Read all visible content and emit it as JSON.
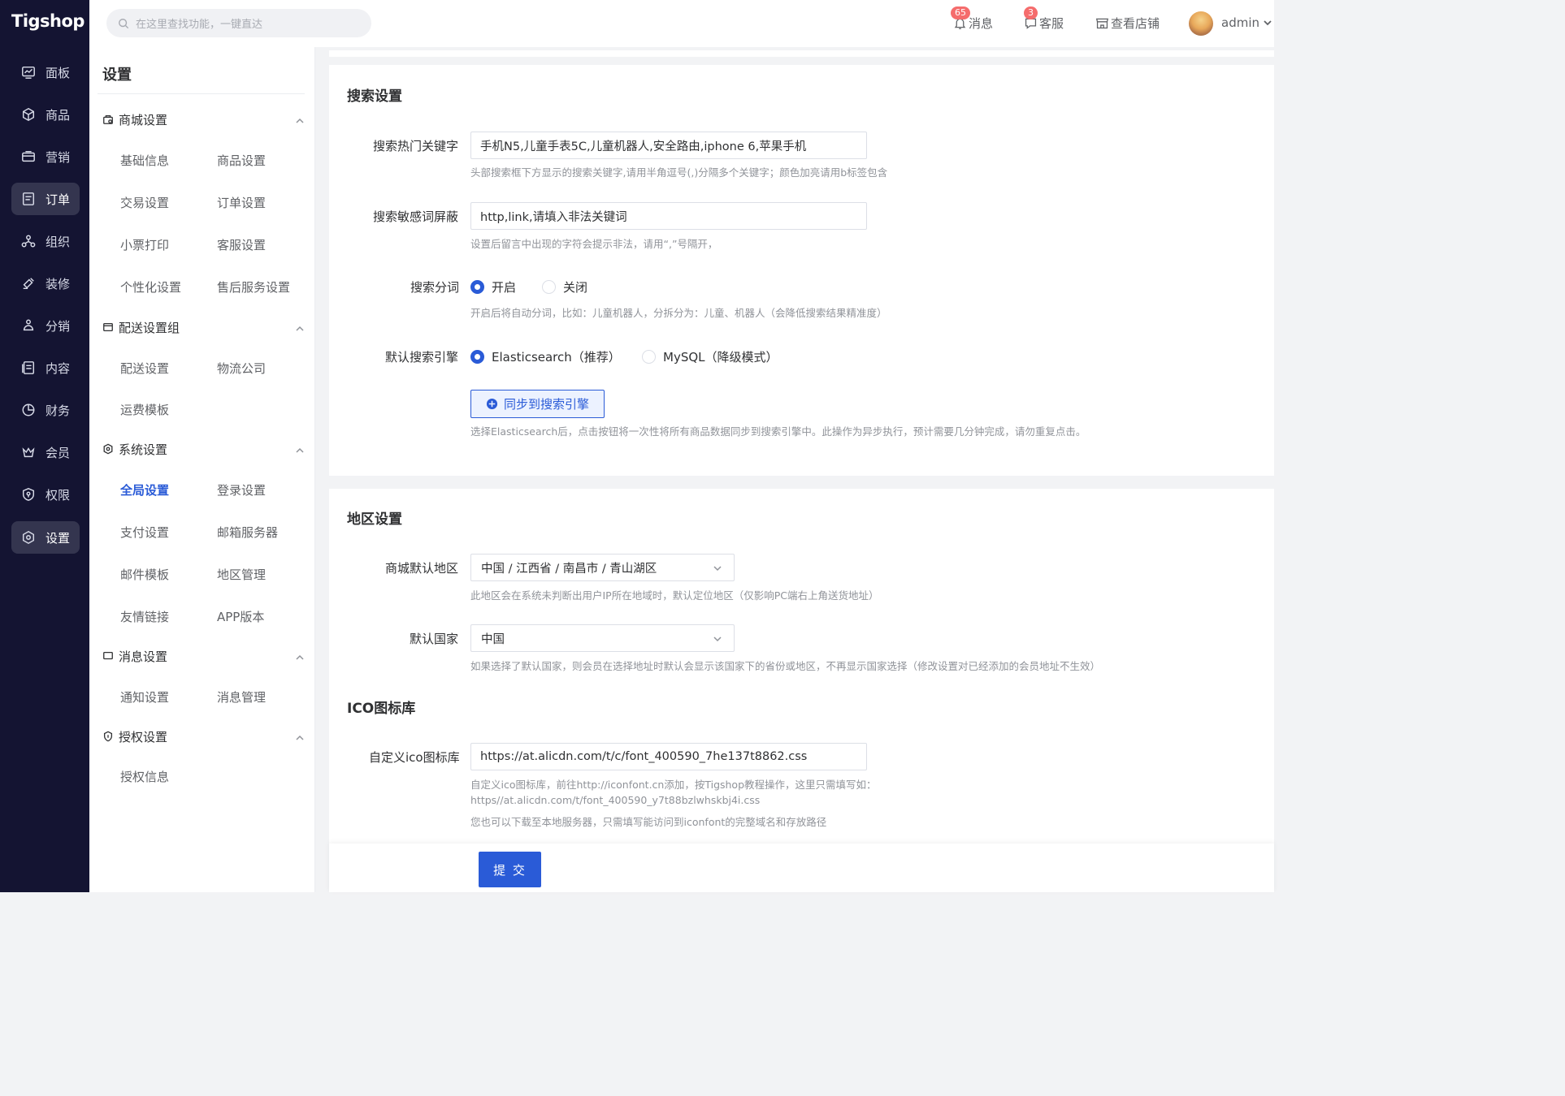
{
  "brand": "Tigshop",
  "rail": [
    {
      "label": "面板",
      "icon": "dashboard-icon"
    },
    {
      "label": "商品",
      "icon": "box-icon"
    },
    {
      "label": "营销",
      "icon": "marketing-icon"
    },
    {
      "label": "订单",
      "icon": "order-icon"
    },
    {
      "label": "组织",
      "icon": "organization-icon"
    },
    {
      "label": "装修",
      "icon": "brush-icon"
    },
    {
      "label": "分销",
      "icon": "distribution-icon"
    },
    {
      "label": "内容",
      "icon": "content-icon"
    },
    {
      "label": "财务",
      "icon": "finance-icon"
    },
    {
      "label": "会员",
      "icon": "crown-icon"
    },
    {
      "label": "权限",
      "icon": "shield-icon"
    },
    {
      "label": "设置",
      "icon": "settings-icon"
    }
  ],
  "topbar": {
    "search_placeholder": "在这里查找功能，一键直达",
    "messages": {
      "label": "消息",
      "count": "65"
    },
    "service": {
      "label": "客服",
      "count": "3"
    },
    "store": {
      "label": "查看店铺"
    },
    "user": "admin"
  },
  "submenu": {
    "title": "设置",
    "groups": [
      {
        "label": "商城设置",
        "items": [
          "基础信息",
          "商品设置",
          "交易设置",
          "订单设置",
          "小票打印",
          "客服设置",
          "个性化设置",
          "售后服务设置"
        ]
      },
      {
        "label": "配送设置组",
        "items": [
          "配送设置",
          "物流公司",
          "运费模板"
        ]
      },
      {
        "label": "系统设置",
        "items": [
          "全局设置",
          "登录设置",
          "支付设置",
          "邮箱服务器",
          "邮件模板",
          "地区管理",
          "友情链接",
          "APP版本"
        ]
      },
      {
        "label": "消息设置",
        "items": [
          "通知设置",
          "消息管理"
        ]
      },
      {
        "label": "授权设置",
        "items": [
          "授权信息"
        ]
      }
    ]
  },
  "search_settings": {
    "title": "搜索设置",
    "hot_keywords": {
      "label": "搜索热门关键字",
      "value": "手机N5,儿童手表5C,儿童机器人,安全路由,iphone 6,苹果手机",
      "hint": "头部搜索框下方显示的搜索关键字,请用半角逗号(,)分隔多个关键字；颜色加亮请用b标签包含"
    },
    "sensitive_words": {
      "label": "搜索敏感词屏蔽",
      "value": "http,link,请填入非法关键词",
      "hint": "设置后留言中出现的字符会提示非法，请用“,”号隔开，"
    },
    "segmentation": {
      "label": "搜索分词",
      "options": [
        "开启",
        "关闭"
      ],
      "selected": "开启",
      "hint": "开启后将自动分词，比如：儿童机器人，分拆分为：儿童、机器人（会降低搜索结果精准度）"
    },
    "engine": {
      "label": "默认搜索引擎",
      "options": [
        "Elasticsearch（推荐）",
        "MySQL（降级模式）"
      ],
      "selected": "Elasticsearch（推荐）",
      "sync_button": "同步到搜索引擎",
      "hint": "选择Elasticsearch后，点击按钮将一次性将所有商品数据同步到搜索引擎中。此操作为异步执行，预计需要几分钟完成，请勿重复点击。"
    }
  },
  "region_settings": {
    "title": "地区设置",
    "default_region": {
      "label": "商城默认地区",
      "value": "中国 / 江西省 / 南昌市 / 青山湖区",
      "hint": "此地区会在系统未判断出用户IP所在地域时，默认定位地区（仅影响PC端右上角送货地址）"
    },
    "default_country": {
      "label": "默认国家",
      "value": "中国",
      "hint": "如果选择了默认国家，则会员在选择地址时默认会显示该国家下的省份或地区，不再显示国家选择（修改设置对已经添加的会员地址不生效）"
    }
  },
  "ico_settings": {
    "title": "ICO图标库",
    "custom_ico": {
      "label": "自定义ico图标库",
      "value": "https://at.alicdn.com/t/c/font_400590_7he137t8862.css",
      "hint_lines": [
        "自定义ico图标库，前往http://iconfont.cn添加，按Tigshop教程操作，这里只需填写如：",
        "https//at.alicdn.com/t/font_400590_y7t88bzlwhskbj4i.css",
        "您也可以下载至本地服务器，只需填写能访问到iconfont的完整域名和存放路径"
      ]
    }
  },
  "submit_label": "提 交",
  "colors": {
    "primary": "#2a5bd7",
    "rail_bg": "#141432",
    "badge": "#f56c6c"
  }
}
